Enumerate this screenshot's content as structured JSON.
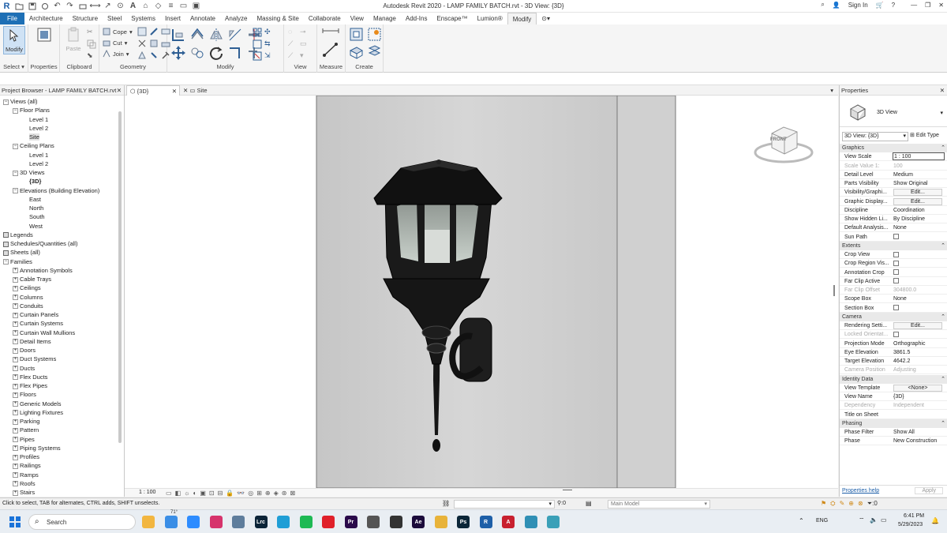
{
  "app": {
    "title": "Autodesk Revit 2020 - LAMP FAMILY BATCH.rvt - 3D View: {3D}",
    "sign_in": "Sign In",
    "help": "?"
  },
  "menu": {
    "tabs": [
      "File",
      "Architecture",
      "Structure",
      "Steel",
      "Systems",
      "Insert",
      "Annotate",
      "Analyze",
      "Massing & Site",
      "Collaborate",
      "View",
      "Manage",
      "Add-Ins",
      "Enscape™",
      "Lumion®",
      "Modify"
    ]
  },
  "ribbon": {
    "modify": "Modify",
    "properties": "Properties",
    "paste": "Paste",
    "cope": "Cope",
    "cut": "Cut",
    "join": "Join",
    "panels": {
      "select": "Select",
      "properties": "Properties",
      "clipboard": "Clipboard",
      "geometry": "Geometry",
      "modify": "Modify",
      "view": "View",
      "measure": "Measure",
      "create": "Create"
    }
  },
  "browser": {
    "title": "Project Browser - LAMP FAMILY BATCH.rvt",
    "nodes": [
      {
        "label": "Views (all)",
        "level": 0,
        "exp": "-"
      },
      {
        "label": "Floor Plans",
        "level": 1,
        "exp": "-"
      },
      {
        "label": "Level 1",
        "level": 2
      },
      {
        "label": "Level 2",
        "level": 2
      },
      {
        "label": "Site",
        "level": 2,
        "selected": true
      },
      {
        "label": "Ceiling Plans",
        "level": 1,
        "exp": "-"
      },
      {
        "label": "Level 1",
        "level": 2
      },
      {
        "label": "Level 2",
        "level": 2
      },
      {
        "label": "3D Views",
        "level": 1,
        "exp": "-"
      },
      {
        "label": "{3D}",
        "level": 2,
        "bold": true
      },
      {
        "label": "Elevations (Building Elevation)",
        "level": 1,
        "exp": "-"
      },
      {
        "label": "East",
        "level": 2
      },
      {
        "label": "North",
        "level": 2
      },
      {
        "label": "South",
        "level": 2
      },
      {
        "label": "West",
        "level": 2
      },
      {
        "label": "Legends",
        "level": 0,
        "icon": true
      },
      {
        "label": "Schedules/Quantities (all)",
        "level": 0,
        "icon": true
      },
      {
        "label": "Sheets (all)",
        "level": 0,
        "icon": true
      },
      {
        "label": "Families",
        "level": 0,
        "exp": "-"
      },
      {
        "label": "Annotation Symbols",
        "level": 1,
        "exp": "+"
      },
      {
        "label": "Cable Trays",
        "level": 1,
        "exp": "+"
      },
      {
        "label": "Ceilings",
        "level": 1,
        "exp": "+"
      },
      {
        "label": "Columns",
        "level": 1,
        "exp": "+"
      },
      {
        "label": "Conduits",
        "level": 1,
        "exp": "+"
      },
      {
        "label": "Curtain Panels",
        "level": 1,
        "exp": "+"
      },
      {
        "label": "Curtain Systems",
        "level": 1,
        "exp": "+"
      },
      {
        "label": "Curtain Wall Mullions",
        "level": 1,
        "exp": "+"
      },
      {
        "label": "Detail Items",
        "level": 1,
        "exp": "+"
      },
      {
        "label": "Doors",
        "level": 1,
        "exp": "+"
      },
      {
        "label": "Duct Systems",
        "level": 1,
        "exp": "+"
      },
      {
        "label": "Ducts",
        "level": 1,
        "exp": "+"
      },
      {
        "label": "Flex Ducts",
        "level": 1,
        "exp": "+"
      },
      {
        "label": "Flex Pipes",
        "level": 1,
        "exp": "+"
      },
      {
        "label": "Floors",
        "level": 1,
        "exp": "+"
      },
      {
        "label": "Generic Models",
        "level": 1,
        "exp": "+"
      },
      {
        "label": "Lighting Fixtures",
        "level": 1,
        "exp": "+"
      },
      {
        "label": "Parking",
        "level": 1,
        "exp": "+"
      },
      {
        "label": "Pattern",
        "level": 1,
        "exp": "+"
      },
      {
        "label": "Pipes",
        "level": 1,
        "exp": "+"
      },
      {
        "label": "Piping Systems",
        "level": 1,
        "exp": "+"
      },
      {
        "label": "Profiles",
        "level": 1,
        "exp": "+"
      },
      {
        "label": "Railings",
        "level": 1,
        "exp": "+"
      },
      {
        "label": "Ramps",
        "level": 1,
        "exp": "+"
      },
      {
        "label": "Roofs",
        "level": 1,
        "exp": "+"
      },
      {
        "label": "Stairs",
        "level": 1,
        "exp": "+"
      }
    ]
  },
  "view_tabs": {
    "tab1": "{3D}",
    "tab2": "Site"
  },
  "viewcube": {
    "face": "FRONT"
  },
  "view_scale": "1 : 100",
  "properties": {
    "title": "Properties",
    "type_name": "3D View",
    "selector": "3D View: {3D}",
    "edit_type": "Edit Type",
    "apply": "Apply",
    "help_link": "Properties help",
    "sections": [
      {
        "name": "Graphics",
        "rows": [
          {
            "k": "View Scale",
            "v": "1 : 100",
            "input": true
          },
          {
            "k": "Scale Value    1:",
            "v": "100",
            "dis": true
          },
          {
            "k": "Detail Level",
            "v": "Medium"
          },
          {
            "k": "Parts Visibility",
            "v": "Show Original"
          },
          {
            "k": "Visibility/Graphi...",
            "v": "Edit...",
            "btn": true
          },
          {
            "k": "Graphic Display...",
            "v": "Edit...",
            "btn": true
          },
          {
            "k": "Discipline",
            "v": "Coordination"
          },
          {
            "k": "Show Hidden Li...",
            "v": "By Discipline"
          },
          {
            "k": "Default Analysis...",
            "v": "None"
          },
          {
            "k": "Sun Path",
            "v": "",
            "cb": true
          }
        ]
      },
      {
        "name": "Extents",
        "rows": [
          {
            "k": "Crop View",
            "v": "",
            "cb": true
          },
          {
            "k": "Crop Region Vis...",
            "v": "",
            "cb": true
          },
          {
            "k": "Annotation Crop",
            "v": "",
            "cb": true
          },
          {
            "k": "Far Clip Active",
            "v": "",
            "cb": true
          },
          {
            "k": "Far Clip Offset",
            "v": "304800.0",
            "dis": true
          },
          {
            "k": "Scope Box",
            "v": "None"
          },
          {
            "k": "Section Box",
            "v": "",
            "cb": true
          }
        ]
      },
      {
        "name": "Camera",
        "rows": [
          {
            "k": "Rendering Setti...",
            "v": "Edit...",
            "btn": true
          },
          {
            "k": "Locked Orientat...",
            "v": "",
            "cb": true,
            "dis": true
          },
          {
            "k": "Projection Mode",
            "v": "Orthographic"
          },
          {
            "k": "Eye Elevation",
            "v": "3861.5"
          },
          {
            "k": "Target Elevation",
            "v": "4642.2"
          },
          {
            "k": "Camera Position",
            "v": "Adjusting",
            "dis": true
          }
        ]
      },
      {
        "name": "Identity Data",
        "rows": [
          {
            "k": "View Template",
            "v": "<None>",
            "btn": true
          },
          {
            "k": "View Name",
            "v": "{3D}"
          },
          {
            "k": "Dependency",
            "v": "Independent",
            "dis": true
          },
          {
            "k": "Title on Sheet",
            "v": ""
          }
        ]
      },
      {
        "name": "Phasing",
        "rows": [
          {
            "k": "Phase Filter",
            "v": "Show All"
          },
          {
            "k": "Phase",
            "v": "New Construction"
          }
        ]
      }
    ]
  },
  "status": {
    "hint": "Click to select, TAB for alternates, CTRL adds, SHIFT unselects.",
    "count1": ":0",
    "model": "Main Model",
    "filter_count": ":0"
  },
  "taskbar": {
    "search": "Search",
    "weather": "71°",
    "lang": "ENG",
    "time": "6:41 PM",
    "date": "5/29/2023",
    "apps": [
      {
        "name": "file-explorer-icon",
        "color": "#f2b640",
        "label": ""
      },
      {
        "name": "photos-icon",
        "color": "#3a8ee6",
        "label": ""
      },
      {
        "name": "zoom-icon",
        "color": "#2d8cff",
        "label": ""
      },
      {
        "name": "instagram-icon",
        "color": "#d6336c",
        "label": ""
      },
      {
        "name": "image-viewer-icon",
        "color": "#5e7d9c",
        "label": ""
      },
      {
        "name": "lightroom-icon",
        "color": "#0b2438",
        "label": "Lrc"
      },
      {
        "name": "edge-icon",
        "color": "#1f9ed6",
        "label": ""
      },
      {
        "name": "spotify-icon",
        "color": "#1db954",
        "label": ""
      },
      {
        "name": "opera-icon",
        "color": "#e0202a",
        "label": ""
      },
      {
        "name": "premiere-icon",
        "color": "#2a0a4a",
        "label": "Pr"
      },
      {
        "name": "media-icon",
        "color": "#555",
        "label": ""
      },
      {
        "name": "player-icon",
        "color": "#333",
        "label": ""
      },
      {
        "name": "after-effects-icon",
        "color": "#1b0b3b",
        "label": "Ae"
      },
      {
        "name": "folder-icon",
        "color": "#e8b33a",
        "label": ""
      },
      {
        "name": "photoshop-icon",
        "color": "#0b2638",
        "label": "Ps"
      },
      {
        "name": "revit-icon",
        "color": "#1d5fa8",
        "label": "R"
      },
      {
        "name": "autocad-icon",
        "color": "#c8202f",
        "label": "A"
      },
      {
        "name": "calculator-icon",
        "color": "#2f8fb5",
        "label": ""
      },
      {
        "name": "app-icon",
        "color": "#3aa0b8",
        "label": ""
      }
    ]
  }
}
